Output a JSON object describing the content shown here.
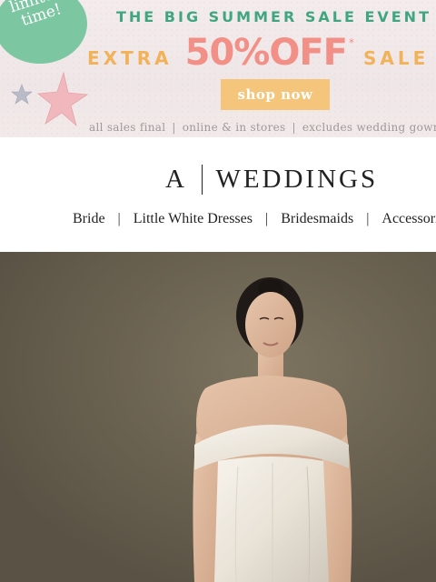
{
  "promo": {
    "badge": "limited\ntime!",
    "headline": "THE BIG SUMMER SALE EVENT",
    "offer_extra": "EXTRA",
    "offer_amount": "50%OFF",
    "offer_asterisk": "*",
    "offer_sale": "SALE",
    "cta": "shop now",
    "fine_print": [
      "all sales final",
      "online & in stores",
      "excludes wedding gowns"
    ],
    "colors": {
      "badge": "#7cc6a2",
      "headline": "#3fa67f",
      "extra": "#f2b25a",
      "amount": "#f28f86",
      "button": "#f4c57a"
    }
  },
  "brand": {
    "logo_left": "A",
    "logo_right": "WEDDINGS"
  },
  "nav": {
    "items": [
      "Bride",
      "Little White Dresses",
      "Bridesmaids",
      "Accessories"
    ]
  },
  "hero": {
    "image_alt": "Model wearing an off-the-shoulder white satin wedding gown"
  }
}
